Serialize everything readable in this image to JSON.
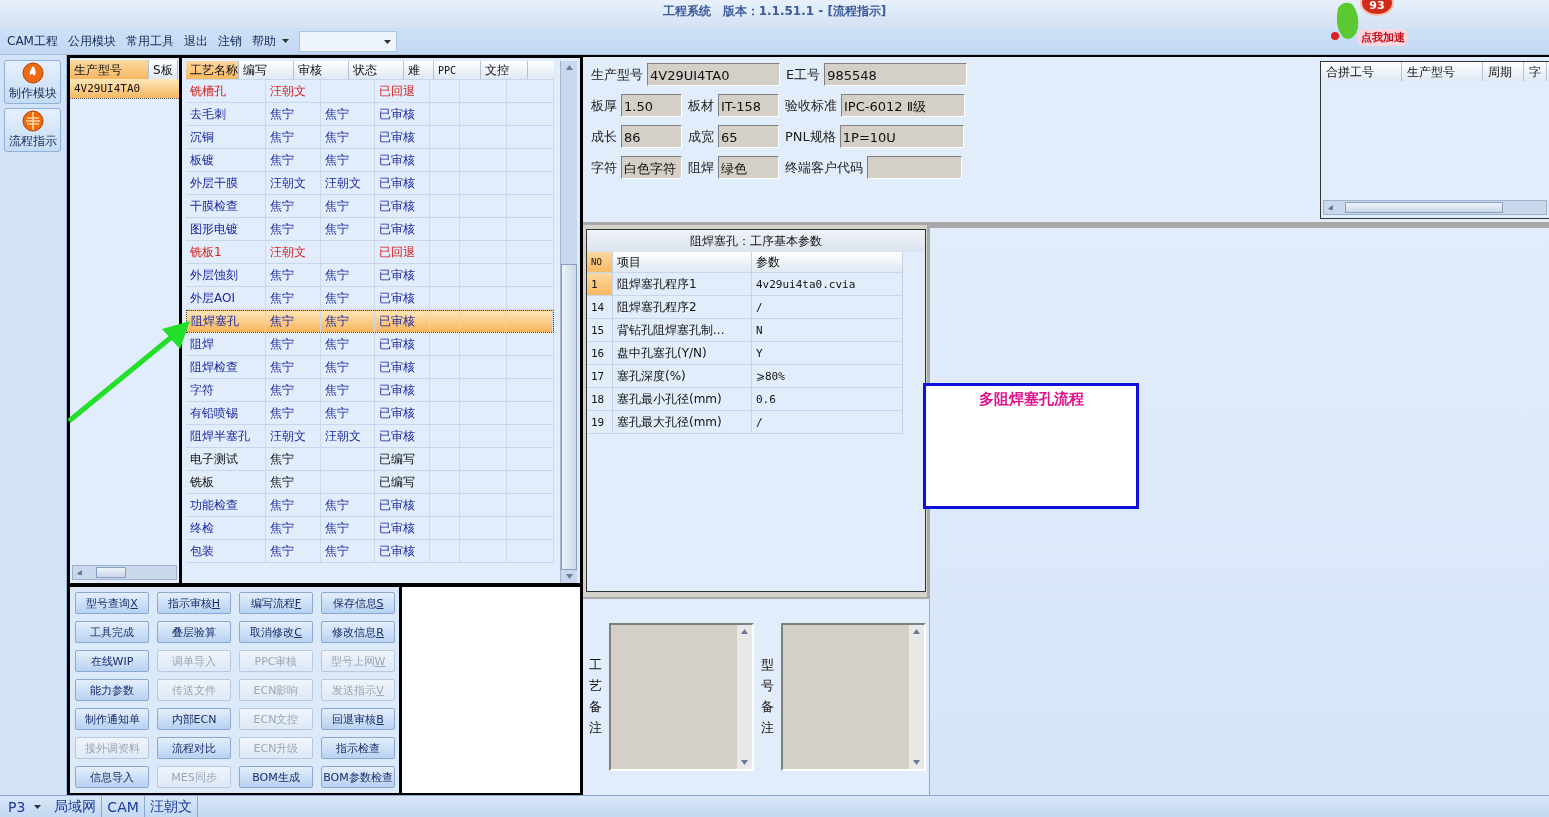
{
  "window": {
    "title": "工程系统　版本：1.1.51.1 - [流程指示]"
  },
  "booster": {
    "count": "93",
    "label": "点我加速"
  },
  "menu": [
    "CAM工程",
    "公用模块",
    "常用工具",
    "退出",
    "注销",
    "帮助"
  ],
  "nav": [
    {
      "label": "制作模块"
    },
    {
      "label": "流程指示"
    }
  ],
  "model_list": {
    "columns": [
      "生产型号",
      "S板"
    ],
    "rows": [
      {
        "model": "4V29UI4TA0",
        "selected": true
      }
    ]
  },
  "process_table": {
    "columns": [
      "工艺名称",
      "编写",
      "审核",
      "状态",
      "难",
      "PPC",
      "文控"
    ],
    "rows": [
      {
        "name": "铣槽孔",
        "writer": "汪朝文",
        "status": "已回退",
        "kind": "returned",
        "selected": false
      },
      {
        "name": "去毛刺",
        "writer": "焦宁",
        "reviewer": "焦宁",
        "status": "已审核",
        "kind": "approved",
        "selected": false
      },
      {
        "name": "沉铜",
        "writer": "焦宁",
        "reviewer": "焦宁",
        "status": "已审核",
        "kind": "approved",
        "selected": false
      },
      {
        "name": "板镀",
        "writer": "焦宁",
        "reviewer": "焦宁",
        "status": "已审核",
        "kind": "approved",
        "selected": false
      },
      {
        "name": "外层干膜",
        "writer": "汪朝文",
        "reviewer": "汪朝文",
        "status": "已审核",
        "kind": "approved",
        "selected": false
      },
      {
        "name": "干膜检查",
        "writer": "焦宁",
        "reviewer": "焦宁",
        "status": "已审核",
        "kind": "approved",
        "selected": false
      },
      {
        "name": "图形电镀",
        "writer": "焦宁",
        "reviewer": "焦宁",
        "status": "已审核",
        "kind": "approved",
        "selected": false
      },
      {
        "name": "铣板1",
        "writer": "汪朝文",
        "status": "已回退",
        "kind": "returned",
        "selected": false
      },
      {
        "name": "外层蚀刻",
        "writer": "焦宁",
        "reviewer": "焦宁",
        "status": "已审核",
        "kind": "approved",
        "selected": false
      },
      {
        "name": "外层AOI",
        "writer": "焦宁",
        "reviewer": "焦宁",
        "status": "已审核",
        "kind": "approved",
        "selected": false
      },
      {
        "name": "阻焊塞孔",
        "writer": "焦宁",
        "reviewer": "焦宁",
        "status": "已审核",
        "kind": "approved",
        "selected": true
      },
      {
        "name": "阻焊",
        "writer": "焦宁",
        "reviewer": "焦宁",
        "status": "已审核",
        "kind": "approved",
        "selected": false
      },
      {
        "name": "阻焊检查",
        "writer": "焦宁",
        "reviewer": "焦宁",
        "status": "已审核",
        "kind": "approved",
        "selected": false
      },
      {
        "name": "字符",
        "writer": "焦宁",
        "reviewer": "焦宁",
        "status": "已审核",
        "kind": "approved",
        "selected": false
      },
      {
        "name": "有铅喷锡",
        "writer": "焦宁",
        "reviewer": "焦宁",
        "status": "已审核",
        "kind": "approved",
        "selected": false
      },
      {
        "name": "阻焊半塞孔",
        "writer": "汪朝文",
        "reviewer": "汪朝文",
        "status": "已审核",
        "kind": "approved",
        "selected": false
      },
      {
        "name": "电子测试",
        "writer": "焦宁",
        "status": "已编写",
        "kind": "draft",
        "selected": false
      },
      {
        "name": "铣板",
        "writer": "焦宁",
        "status": "已编写",
        "kind": "draft",
        "selected": false
      },
      {
        "name": "功能检查",
        "writer": "焦宁",
        "reviewer": "焦宁",
        "status": "已审核",
        "kind": "approved",
        "selected": false
      },
      {
        "name": "终检",
        "writer": "焦宁",
        "reviewer": "焦宁",
        "status": "已审核",
        "kind": "approved",
        "selected": false
      },
      {
        "name": "包装",
        "writer": "焦宁",
        "reviewer": "焦宁",
        "status": "已审核",
        "kind": "approved",
        "selected": false
      }
    ]
  },
  "buttons": [
    {
      "label": "型号查询",
      "hotkey": "X",
      "disabled": false
    },
    {
      "label": "指示审核",
      "hotkey": "H",
      "disabled": false
    },
    {
      "label": "编写流程",
      "hotkey": "F",
      "disabled": false
    },
    {
      "label": "保存信息",
      "hotkey": "S",
      "disabled": false
    },
    {
      "label": "工具完成",
      "disabled": false
    },
    {
      "label": "叠层验算",
      "disabled": false
    },
    {
      "label": "取消修改",
      "hotkey": "C",
      "disabled": false
    },
    {
      "label": "修改信息",
      "hotkey": "R",
      "disabled": false
    },
    {
      "label": "在线WIP",
      "disabled": false
    },
    {
      "label": "调单导入",
      "disabled": true
    },
    {
      "label": "PPC审核",
      "disabled": true
    },
    {
      "label": "型号上网",
      "hotkey": "W",
      "disabled": true
    },
    {
      "label": "能力参数",
      "disabled": false
    },
    {
      "label": "传送文件",
      "disabled": true
    },
    {
      "label": "ECN影响",
      "disabled": true
    },
    {
      "label": "发送指示",
      "hotkey": "V",
      "disabled": true
    },
    {
      "label": "制作通知单",
      "disabled": false
    },
    {
      "label": "内部ECN",
      "disabled": false
    },
    {
      "label": "ECN文控",
      "disabled": true
    },
    {
      "label": "回退审核",
      "hotkey": "B",
      "disabled": false
    },
    {
      "label": "接外调资料",
      "disabled": true
    },
    {
      "label": "流程对比",
      "disabled": false
    },
    {
      "label": "ECN升级",
      "disabled": true
    },
    {
      "label": "指示检查",
      "disabled": false
    },
    {
      "label": "信息导入",
      "disabled": false
    },
    {
      "label": "MES同步",
      "disabled": true
    },
    {
      "label": "BOM生成",
      "disabled": false
    },
    {
      "label": "BOM参数检查",
      "disabled": false
    }
  ],
  "info_form": [
    [
      {
        "label": "生产型号",
        "value": "4V29UI4TA0"
      },
      {
        "label": "E工号",
        "value": "985548"
      }
    ],
    [
      {
        "label": "板厚",
        "value": "1.50"
      },
      {
        "label": "板材",
        "value": "IT-158"
      },
      {
        "label": "验收标准",
        "value": "IPC-6012 Ⅱ级"
      }
    ],
    [
      {
        "label": "成长",
        "value": "86"
      },
      {
        "label": "成宽",
        "value": "65"
      },
      {
        "label": "PNL规格",
        "value": "1P=10U"
      }
    ],
    [
      {
        "label": "字符",
        "value": "白色字符"
      },
      {
        "label": "阻焊",
        "value": "绿色"
      },
      {
        "label": "终端客户代码"
      }
    ]
  ],
  "merge_table": {
    "columns": [
      "合拼工号",
      "生产型号",
      "周期",
      "字"
    ]
  },
  "params": {
    "title": "阻焊塞孔：工序基本参数",
    "columns": [
      "NO",
      "项目",
      "参数"
    ],
    "rows": [
      {
        "no": "1",
        "item": "阻焊塞孔程序1",
        "value": "4v29ui4ta0.cvia",
        "selected": true
      },
      {
        "no": "14",
        "item": "阻焊塞孔程序2",
        "value": "/",
        "selected": false
      },
      {
        "no": "15",
        "item": "背钻孔阻焊塞孔制...",
        "value": "N",
        "selected": false
      },
      {
        "no": "16",
        "item": "盘中孔塞孔(Y/N)",
        "value": "Y",
        "selected": false
      },
      {
        "no": "17",
        "item": "塞孔深度(%)",
        "value": "⩾80%",
        "selected": false
      },
      {
        "no": "18",
        "item": "塞孔最小孔径(mm)",
        "value": "0.6",
        "selected": false
      },
      {
        "no": "19",
        "item": "塞孔最大孔径(mm)",
        "value": "/",
        "selected": false
      }
    ]
  },
  "notes": [
    {
      "label": "工艺备注"
    },
    {
      "label": "型号备注"
    }
  ],
  "flow_box": {
    "title": "多阻焊塞孔流程"
  },
  "status_bar": {
    "page": "P3",
    "items": [
      "局域网",
      "CAM",
      "汪朝文"
    ]
  }
}
